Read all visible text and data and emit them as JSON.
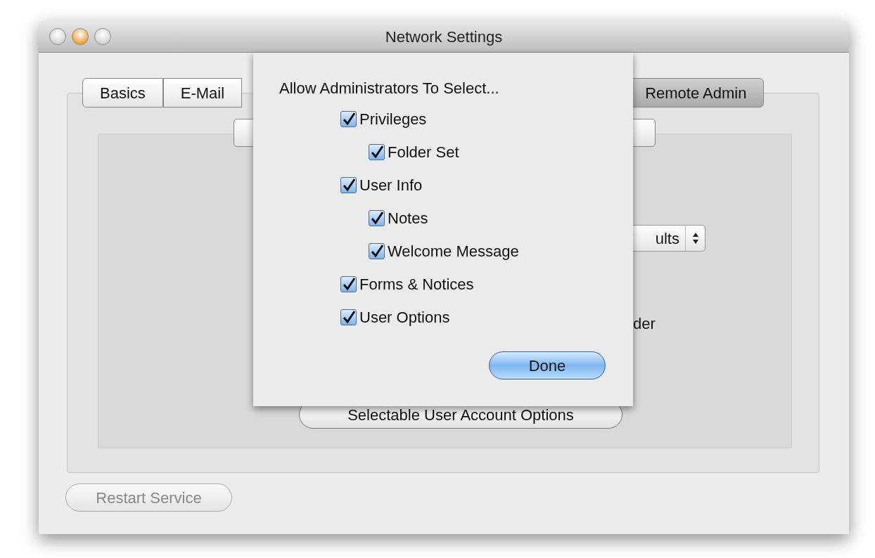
{
  "window": {
    "title": "Network Settings"
  },
  "tabs": [
    {
      "label": "Basics",
      "selected": false
    },
    {
      "label": "E-Mail",
      "selected": false
    },
    {
      "label": "Remote Admin",
      "selected": true
    }
  ],
  "panel": {
    "popup_value": "ults",
    "radio_fragment": "der",
    "options_button": "Selectable User Account Options"
  },
  "sheet": {
    "title": "Allow Administrators To Select...",
    "options": [
      {
        "label": "Privileges",
        "checked": true,
        "children": [
          {
            "label": "Folder Set",
            "checked": true
          }
        ]
      },
      {
        "label": "User Info",
        "checked": true,
        "children": [
          {
            "label": "Notes",
            "checked": true
          },
          {
            "label": "Welcome Message",
            "checked": true
          }
        ]
      },
      {
        "label": "Forms & Notices",
        "checked": true
      },
      {
        "label": "User Options",
        "checked": true
      }
    ],
    "done_button": "Done"
  },
  "restart_button": {
    "label": "Restart Service",
    "disabled": true
  }
}
